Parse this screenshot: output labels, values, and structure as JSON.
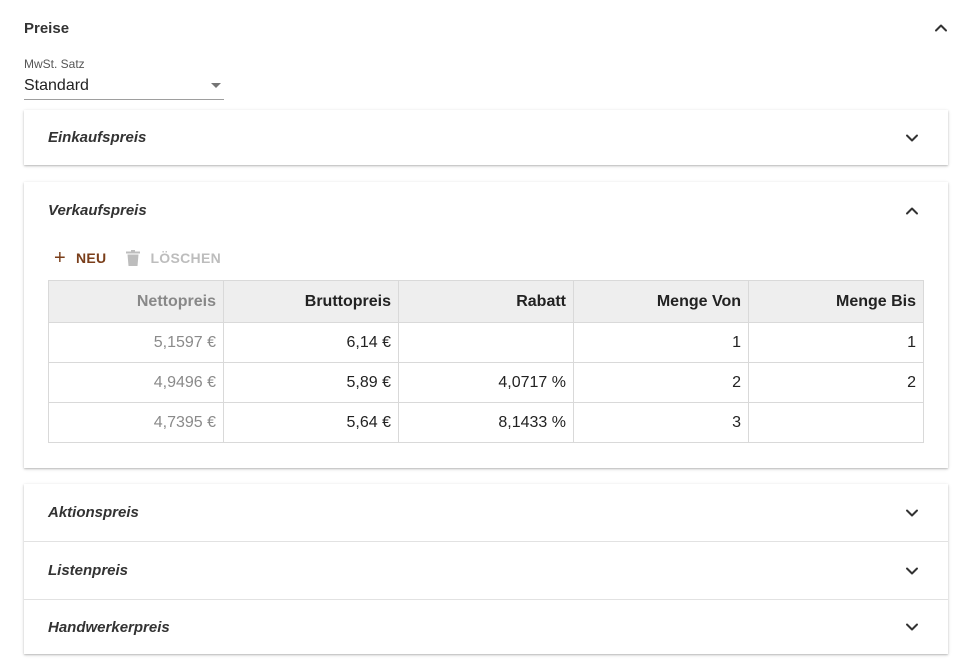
{
  "section": {
    "title": "Preise"
  },
  "vat": {
    "label": "MwSt. Satz",
    "value": "Standard"
  },
  "panels": {
    "einkauf": {
      "title": "Einkaufspreis"
    },
    "verkauf": {
      "title": "Verkaufspreis"
    },
    "aktion": {
      "title": "Aktionspreis"
    },
    "listen": {
      "title": "Listenpreis"
    },
    "handwerker": {
      "title": "Handwerkerpreis"
    }
  },
  "toolbar": {
    "new_label": "NEU",
    "delete_label": "LÖSCHEN"
  },
  "table": {
    "headers": [
      "Nettopreis",
      "Bruttopreis",
      "Rabatt",
      "Menge Von",
      "Menge Bis"
    ],
    "rows": [
      [
        "5,1597 €",
        "6,14 €",
        "",
        "1",
        "1"
      ],
      [
        "4,9496 €",
        "5,89 €",
        "4,0717 %",
        "2",
        "2"
      ],
      [
        "4,7395 €",
        "5,64 €",
        "8,1433 %",
        "3",
        ""
      ]
    ]
  },
  "icons": {
    "collapse": "chevron-up-icon",
    "expand": "chevron-down-icon",
    "add": "plus-icon",
    "delete": "trash-icon",
    "dropdown": "caret-down-icon"
  },
  "colors": {
    "accent": "#7a3e1a",
    "disabled": "#bdbdbd",
    "header_bg": "#eeeeee"
  }
}
